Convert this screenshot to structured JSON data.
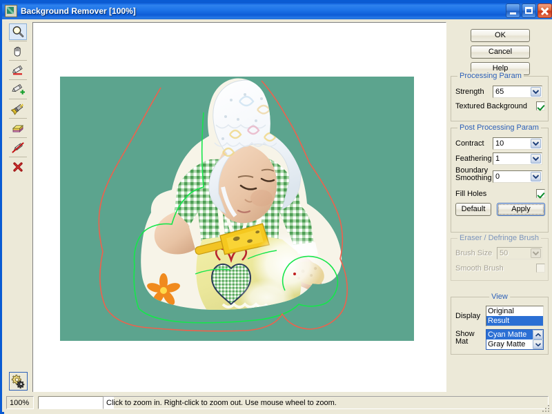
{
  "window": {
    "title": "Background Remover [100%]",
    "icon": "app-icon",
    "controls": [
      {
        "name": "minimize",
        "glyph": "_"
      },
      {
        "name": "maximize",
        "glyph": "□"
      },
      {
        "name": "close",
        "glyph": "×"
      }
    ]
  },
  "toolbar": {
    "tools": [
      {
        "name": "zoom-tool",
        "label": "Zoom",
        "selected": true
      },
      {
        "name": "pan-tool",
        "label": "Pan / Hand",
        "selected": false
      },
      {
        "name": "mark-background-tool",
        "label": "Mark Background (red marker)",
        "selected": false
      },
      {
        "name": "mark-foreground-tool",
        "label": "Mark Foreground (green marker)",
        "selected": false
      },
      {
        "name": "defringe-brush-tool",
        "label": "Defringe Brush",
        "selected": false
      },
      {
        "name": "eraser-tool",
        "label": "Eraser",
        "selected": false
      },
      {
        "name": "delete-stroke-tool",
        "label": "Remove Marker",
        "selected": false
      },
      {
        "name": "clear-all-tool",
        "label": "Clear All",
        "selected": false
      }
    ],
    "settings_button": {
      "name": "settings-button",
      "label": "Settings"
    }
  },
  "canvas": {
    "matte_color": "#5CA48E",
    "background": "#FFFFFF",
    "foreground_stroke_color": "#16E64B",
    "background_stroke_color": "#F0604C",
    "image_subject": "baby wearing white lace bonnet and green gingham dress with yellow apron holding a yellow toy shovel"
  },
  "actions": {
    "ok": "OK",
    "cancel": "Cancel",
    "help": "Help"
  },
  "processing_param": {
    "title": "Processing Param",
    "strength": {
      "label": "Strength",
      "value": "65"
    },
    "textured_background": {
      "label": "Textured Background",
      "checked": true
    }
  },
  "post_processing_param": {
    "title": "Post Processing Param",
    "contract": {
      "label": "Contract",
      "value": "10"
    },
    "feathering": {
      "label": "Feathering",
      "value": "1"
    },
    "boundary_smoothing": {
      "label_line1": "Boundary",
      "label_line2": "Smoothing",
      "value": "0"
    },
    "fill_holes": {
      "label": "Fill Holes",
      "checked": true
    },
    "default_button": "Default",
    "apply_button": "Apply"
  },
  "eraser_defringe_brush": {
    "title": "Eraser / Defringe  Brush",
    "enabled": false,
    "brush_size": {
      "label": "Brush Size",
      "value": "50"
    },
    "smooth_brush": {
      "label": "Smooth Brush",
      "checked": false
    }
  },
  "view": {
    "title": "View",
    "display": {
      "label": "Display",
      "options": [
        "Original",
        "Result"
      ],
      "selected": "Result"
    },
    "show_mat": {
      "label_line1": "Show",
      "label_line2": "Mat",
      "options": [
        "Cyan Matte",
        "Gray Matte"
      ],
      "selected": "Cyan Matte"
    }
  },
  "statusbar": {
    "zoom": "100%",
    "progress_value": "",
    "hint": "Click to zoom in. Right-click to zoom out. Use mouse wheel to zoom."
  }
}
